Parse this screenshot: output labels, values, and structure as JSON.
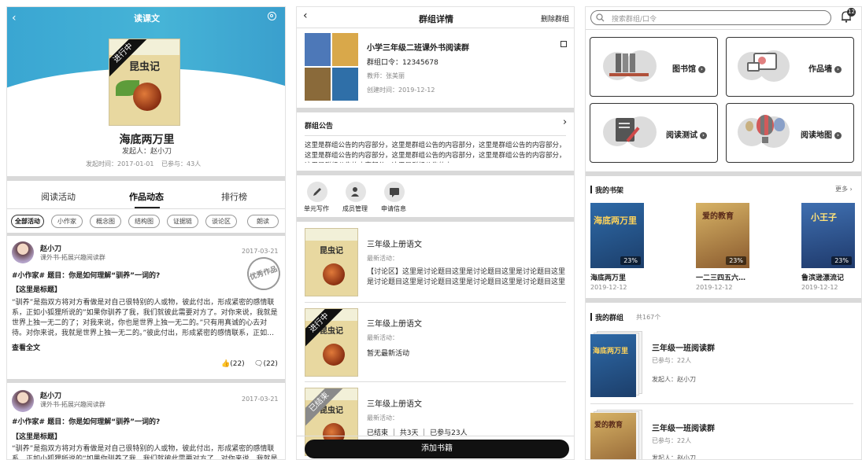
{
  "colors": {
    "header_blue": "#3aa6d2",
    "primary_black": "#111111",
    "divider_gray": "#d9d9d9"
  },
  "p1": {
    "title": "读课文",
    "book": {
      "cover_text": "昆虫记",
      "ribbon": "进行中",
      "name": "海底两万里",
      "sponsor": "发起人：赵小刀",
      "start_time": "发起时间：2017-01-01",
      "joined": "已参与：43人"
    },
    "tabs": [
      "阅读活动",
      "作品动态",
      "排行榜"
    ],
    "chips": [
      "全部活动",
      "小作家",
      "概念图",
      "结构图",
      "证据链",
      "谈论区",
      "朗读"
    ],
    "posts": [
      {
        "author": "赵小刀",
        "sub": "课外书-拓展兴趣阅读群",
        "date": "2017-03-21",
        "topic": "#小作家# 题目：你是如何理解“驯养”一词的?",
        "heading": "【这里是标题】",
        "body": "“驯养”是指双方将对方看做是对自己很特别的人或物，彼此付出，形成紧密的感情联系，正如小狐狸所说的”如果你驯养了我，我们就彼此需要对方了。对你来说，我就是世界上独一无二的了；对我来说，你也是世界上独一无二的。”只有用真诚的心去对待。对你来说，我就是世界上独一无二的。”彼此付出，形成紧密的感情联系，正如…",
        "more": "查看全文",
        "likes": "(22)",
        "comments": "(22)",
        "stamp": "优秀作品"
      },
      {
        "author": "赵小刀",
        "sub": "课外书-拓展兴趣阅读群",
        "date": "2017-03-21",
        "topic": "#小作家# 题目：你是如何理解“驯养”一词的?",
        "heading": "【这里是标题】",
        "body": "“驯养”是指双方将对方看做是对自己很特别的人或物，彼此付出，形成紧密的感情联系，正如小狐狸所说的”如果你驯养了我，我们就彼此需要对方了。对你来说，我就是"
      }
    ]
  },
  "p2": {
    "title": "群组详情",
    "delete": "删除群组",
    "group": {
      "name": "小学三年级二班课外书阅读群",
      "code": "群组口令：12345678",
      "teacher": "教师：张美丽",
      "created": "创建时间：2019-12-12"
    },
    "notice": {
      "label": "群组公告",
      "text": "这里是群组公告的内容部分，这里是群组公告的内容部分，这里是群组公告的内容部分，这里是群组公告的内容部分，这里是群组公告的内容部分，这里是群组公告的内容部分，这里是群组公告的内容部分，这里是群组公告的内…"
    },
    "actions": [
      "单元写作",
      "成员管理",
      "申请信息"
    ],
    "books": [
      {
        "title": "三年级上册语文",
        "latest": "最新活动：",
        "desc": "【讨论区】这里是讨论题目这里是讨论题目这里是讨论题目这里是讨论题目这里是讨论题目这里是讨论题目这里是讨论题目这里是…"
      },
      {
        "title": "三年级上册语文",
        "latest": "最新活动：",
        "desc": "暂无最新活动",
        "ribbon": "进行中"
      },
      {
        "title": "三年级上册语文",
        "latest": "最新活动：",
        "desc": "已结束 ｜ 共3天 ｜ 已参与23人",
        "ribbon": "已结束"
      }
    ],
    "add_button": "添加书籍"
  },
  "p3": {
    "search_placeholder": "搜索群组/口令",
    "notify_count": "12",
    "cards": [
      {
        "label": "图书馆",
        "icon": "bookshelf-icon"
      },
      {
        "label": "作品墙",
        "icon": "gallery-icon"
      },
      {
        "label": "阅读测试",
        "icon": "test-paper-icon"
      },
      {
        "label": "阅读地图",
        "icon": "balloon-icon"
      }
    ],
    "shelf": {
      "title": "我的书架",
      "more": "更多",
      "books": [
        {
          "name": "海底两万里",
          "date": "2019-12-12",
          "pct": "23%",
          "cover": "海底两万里"
        },
        {
          "name": "一二三四五六…",
          "date": "2019-12-12",
          "pct": "23%",
          "cover": "爱的教育"
        },
        {
          "name": "鲁滨逊漂流记",
          "date": "2019-12-12",
          "pct": "23%",
          "cover": "小王子"
        }
      ]
    },
    "groups": {
      "title": "我的群组",
      "count": "共167个",
      "items": [
        {
          "name": "三年级一班阅读群",
          "joined": "已参与：22人",
          "sponsor": "发起人：赵小刀",
          "cover": "海底两万里"
        },
        {
          "name": "三年级一班阅读群",
          "joined": "已参与：22人",
          "sponsor": "发起人：赵小刀",
          "cover": "爱的教育"
        }
      ]
    }
  }
}
